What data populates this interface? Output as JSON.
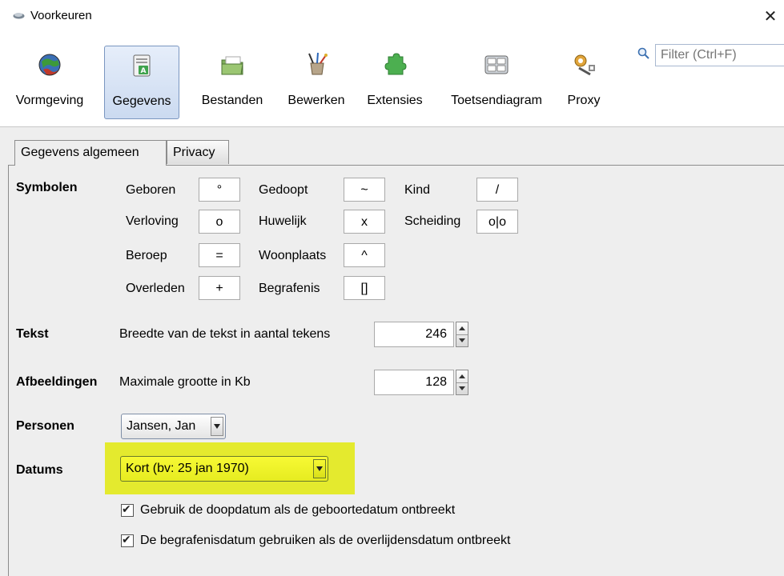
{
  "window": {
    "title": "Voorkeuren",
    "close_glyph": "✕"
  },
  "toolbar": {
    "items": [
      {
        "label": "Vormgeving",
        "icon": "globe-icon"
      },
      {
        "label": "Gegevens",
        "icon": "data-card-icon",
        "active": true
      },
      {
        "label": "Bestanden",
        "icon": "folder-icon"
      },
      {
        "label": "Bewerken",
        "icon": "brushes-icon"
      },
      {
        "label": "Extensies",
        "icon": "puzzle-icon"
      },
      {
        "label": "Toetsendiagram",
        "icon": "keyboard-icon"
      },
      {
        "label": "Proxy",
        "icon": "gears-icon"
      }
    ],
    "filter_placeholder": "Filter (Ctrl+F)"
  },
  "tabs": [
    {
      "label": "Gegevens algemeen",
      "selected": true
    },
    {
      "label": "Privacy",
      "selected": false
    }
  ],
  "symbolen": {
    "heading": "Symbolen",
    "rows": [
      [
        {
          "label": "Geboren",
          "value": "°"
        },
        {
          "label": "Gedoopt",
          "value": "~"
        },
        {
          "label": "Kind",
          "value": "/"
        }
      ],
      [
        {
          "label": "Verloving",
          "value": "o"
        },
        {
          "label": "Huwelijk",
          "value": "x"
        },
        {
          "label": "Scheiding",
          "value": "o|o"
        }
      ],
      [
        {
          "label": "Beroep",
          "value": "="
        },
        {
          "label": "Woonplaats",
          "value": "^"
        }
      ],
      [
        {
          "label": "Overleden",
          "value": "+"
        },
        {
          "label": "Begrafenis",
          "value": "[]"
        }
      ]
    ]
  },
  "tekst": {
    "heading": "Tekst",
    "label": "Breedte van de tekst in aantal tekens",
    "value": "246"
  },
  "afbeeldingen": {
    "heading": "Afbeeldingen",
    "label": "Maximale grootte in Kb",
    "value": "128"
  },
  "personen": {
    "heading": "Personen",
    "selected": "Jansen, Jan"
  },
  "datums": {
    "heading": "Datums",
    "selected": "Kort (bv: 25 jan 1970)",
    "highlight_color": "#e4ea2e",
    "options": [
      {
        "label": "Gebruik de doopdatum als de geboortedatum ontbreekt",
        "checked": true
      },
      {
        "label": "De begrafenisdatum gebruiken als de overlijdensdatum ontbreekt",
        "checked": true
      }
    ]
  }
}
